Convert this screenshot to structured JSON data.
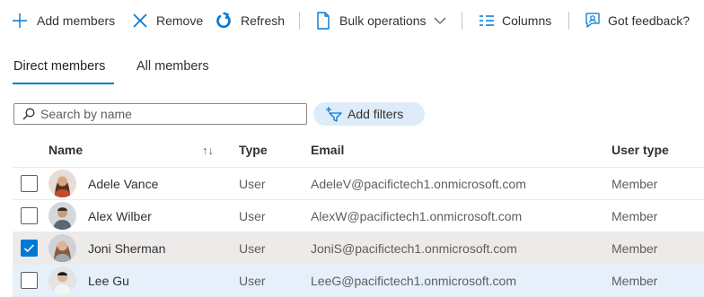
{
  "toolbar": {
    "add_members": "Add members",
    "remove": "Remove",
    "refresh": "Refresh",
    "bulk_operations": "Bulk operations",
    "columns": "Columns",
    "feedback": "Got feedback?"
  },
  "tabs": [
    {
      "label": "Direct members",
      "active": true
    },
    {
      "label": "All members",
      "active": false
    }
  ],
  "search": {
    "placeholder": "Search by name",
    "value": ""
  },
  "filters": {
    "label": "Add filters"
  },
  "table": {
    "columns": [
      "Name",
      "Type",
      "Email",
      "User type"
    ],
    "sort_indicator": "↑↓",
    "rows": [
      {
        "name": "Adele Vance",
        "type": "User",
        "email": "AdeleV@pacifictech1.onmicrosoft.com",
        "user_type": "Member",
        "checked": false
      },
      {
        "name": "Alex Wilber",
        "type": "User",
        "email": "AlexW@pacifictech1.onmicrosoft.com",
        "user_type": "Member",
        "checked": false
      },
      {
        "name": "Joni Sherman",
        "type": "User",
        "email": "JoniS@pacifictech1.onmicrosoft.com",
        "user_type": "Member",
        "checked": true
      },
      {
        "name": "Lee Gu",
        "type": "User",
        "email": "LeeG@pacifictech1.onmicrosoft.com",
        "user_type": "Member",
        "checked": false
      }
    ]
  },
  "colors": {
    "accent": "#0078d4",
    "selected_row": "#edebe9",
    "hover_row": "#e6f0fa",
    "filter_pill": "#deecf9"
  }
}
